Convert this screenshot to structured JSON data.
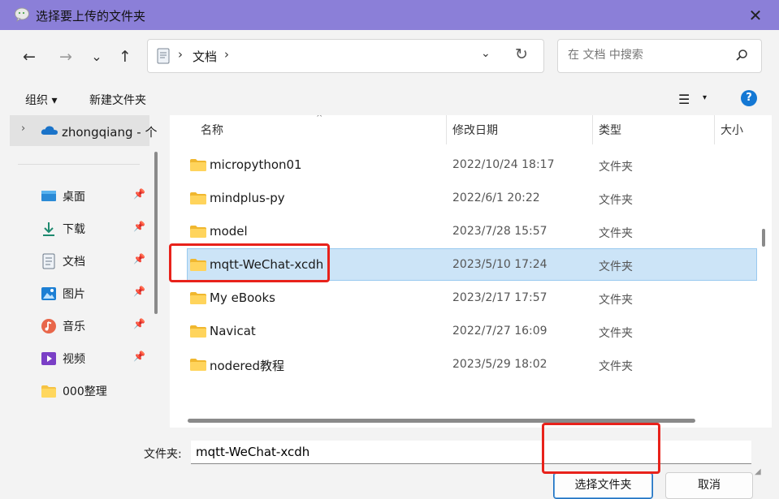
{
  "titlebar": {
    "title": "选择要上传的文件夹",
    "close_glyph": "✕",
    "app_icon": "wechat-icon"
  },
  "nav_buttons": {
    "back": "←",
    "forward": "→",
    "recent": "⌄",
    "up": "↑"
  },
  "address": {
    "separator": "›",
    "crumb": "文档",
    "dropdown": "⌄",
    "refresh": "↻"
  },
  "search": {
    "placeholder": "在 文档 中搜索"
  },
  "commandbar": {
    "organize": "组织 ▾",
    "new_folder": "新建文件夹",
    "view_icon": "☰",
    "view_dropdown": "▾",
    "help": "?"
  },
  "sidebar": {
    "onedrive": {
      "chevron": "›",
      "label": "zhongqiang - 个"
    },
    "items": [
      {
        "label": "桌面",
        "icon": "desktop-icon",
        "pin": "📌"
      },
      {
        "label": "下载",
        "icon": "download-icon",
        "pin": "📌"
      },
      {
        "label": "文档",
        "icon": "documents-icon",
        "pin": "📌"
      },
      {
        "label": "图片",
        "icon": "pictures-icon",
        "pin": "📌"
      },
      {
        "label": "音乐",
        "icon": "music-icon",
        "pin": "📌"
      },
      {
        "label": "视频",
        "icon": "video-icon",
        "pin": "📌"
      },
      {
        "label": "000整理",
        "icon": "folder-icon",
        "pin": ""
      }
    ]
  },
  "columns": {
    "name": "名称",
    "modified": "修改日期",
    "type": "类型",
    "size": "大小",
    "sort_arrow": "^"
  },
  "files": [
    {
      "name": "micropython01",
      "date": "2022/10/24 18:17",
      "type": "文件夹",
      "selected": false
    },
    {
      "name": "mindplus-py",
      "date": "2022/6/1 20:22",
      "type": "文件夹",
      "selected": false
    },
    {
      "name": "model",
      "date": "2023/7/28 15:57",
      "type": "文件夹",
      "selected": false
    },
    {
      "name": "mqtt-WeChat-xcdh",
      "date": "2023/5/10 17:24",
      "type": "文件夹",
      "selected": true
    },
    {
      "name": "My eBooks",
      "date": "2023/2/17 17:57",
      "type": "文件夹",
      "selected": false
    },
    {
      "name": "Navicat",
      "date": "2022/7/27 16:09",
      "type": "文件夹",
      "selected": false
    },
    {
      "name": "nodered教程",
      "date": "2023/5/29 18:02",
      "type": "文件夹",
      "selected": false
    }
  ],
  "footer": {
    "folder_label": "文件夹:",
    "folder_value": "mqtt-WeChat-xcdh",
    "select_button": "选择文件夹",
    "cancel_button": "取消"
  },
  "colors": {
    "titlebar": "#8b7fd8",
    "selection": "#cce4f7",
    "highlight_box": "#e8221b",
    "accent": "#1478d4",
    "folder": "#f6c343"
  }
}
